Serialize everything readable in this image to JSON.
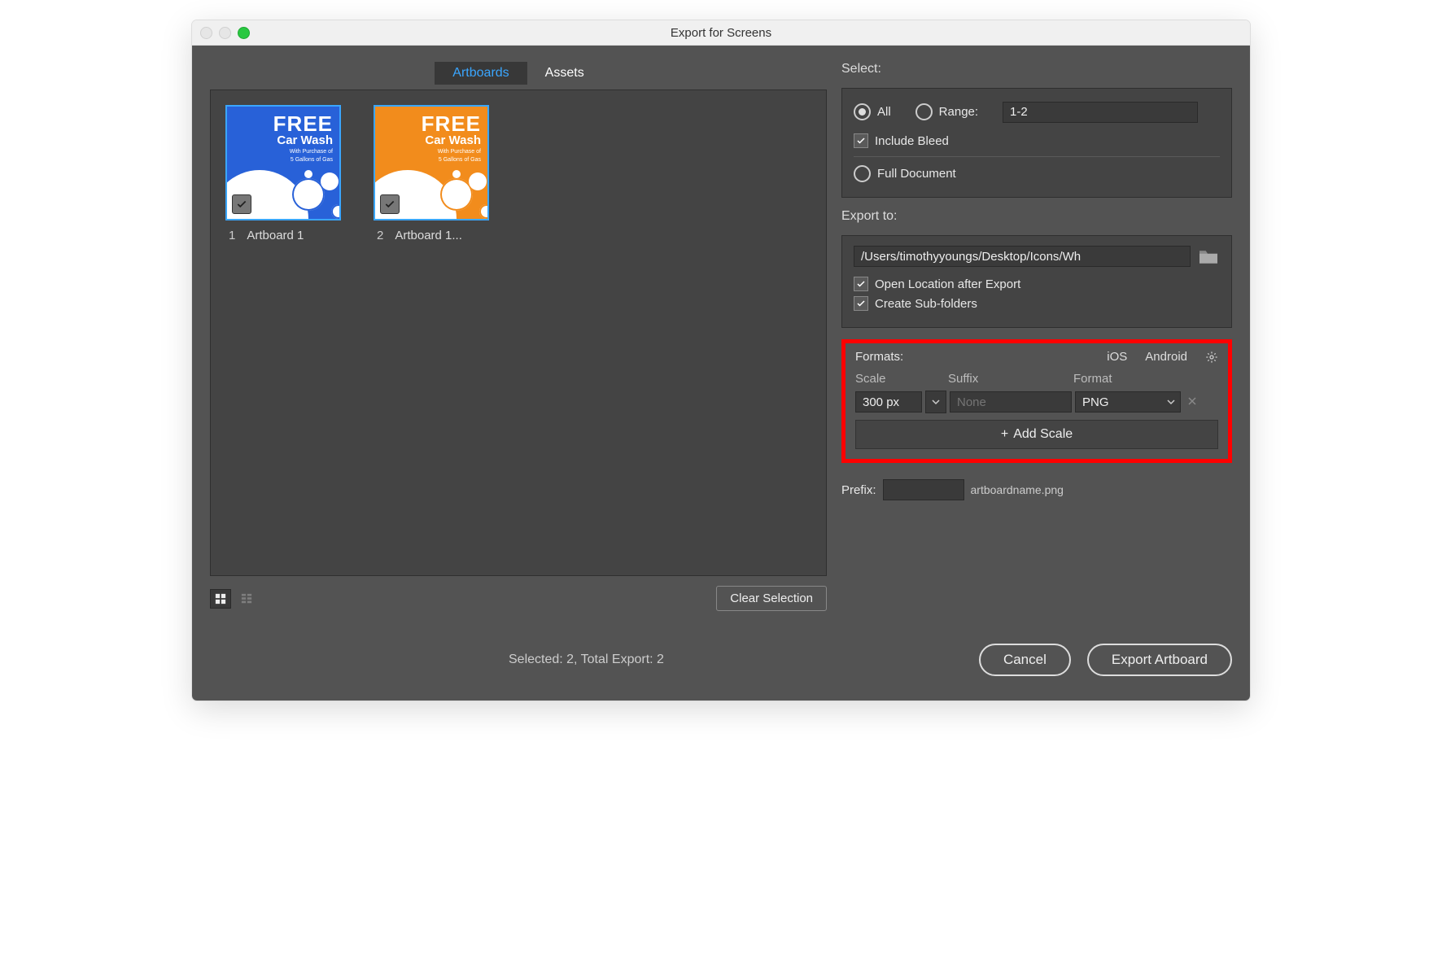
{
  "window": {
    "title": "Export for Screens"
  },
  "tabs": {
    "artboards": "Artboards",
    "assets": "Assets"
  },
  "artboards": [
    {
      "index": "1",
      "label": "Artboard 1",
      "color": "blue"
    },
    {
      "index": "2",
      "label": "Artboard 1...",
      "color": "orange"
    }
  ],
  "thumb_text": {
    "big": "FREE",
    "mid": "Car Wash",
    "sm1": "With Purchase of",
    "sm2": "5 Gallons of Gas"
  },
  "select": {
    "label": "Select:",
    "all": "All",
    "range": "Range:",
    "range_value": "1-2",
    "include_bleed": "Include Bleed",
    "full_document": "Full Document"
  },
  "export_to": {
    "label": "Export to:",
    "path": "/Users/timothyyoungs/Desktop/Icons/Wh",
    "open_location": "Open Location after Export",
    "create_subfolders": "Create Sub-folders"
  },
  "formats": {
    "label": "Formats:",
    "ios": "iOS",
    "android": "Android",
    "col_scale": "Scale",
    "col_suffix": "Suffix",
    "col_format": "Format",
    "row": {
      "scale": "300 px",
      "suffix_placeholder": "None",
      "format": "PNG"
    },
    "add_scale": "Add Scale"
  },
  "footer": {
    "clear": "Clear Selection",
    "prefix_label": "Prefix:",
    "example": "artboardname.png",
    "status": "Selected: 2, Total Export: 2",
    "cancel": "Cancel",
    "export": "Export Artboard"
  }
}
